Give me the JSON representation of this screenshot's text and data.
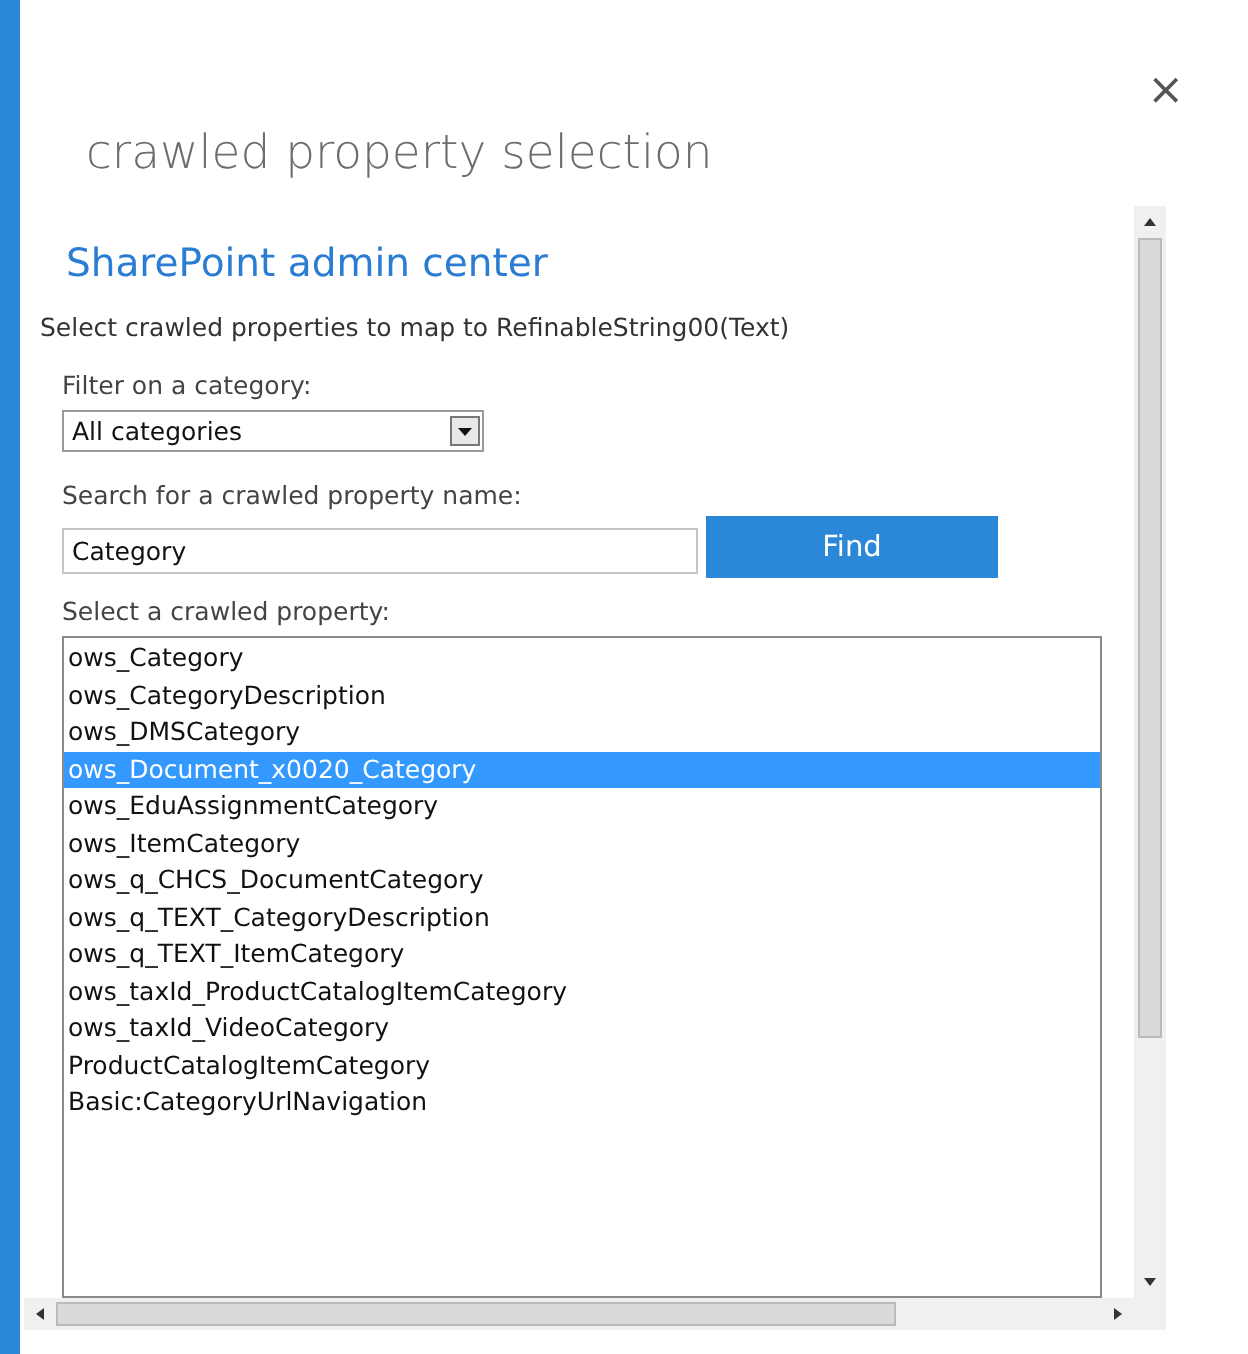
{
  "dialog": {
    "title": "crawled property selection",
    "close": "×"
  },
  "frame": {
    "heading": "SharePoint admin center",
    "description": "Select crawled properties to map to RefinableString00(Text)",
    "filter": {
      "label": "Filter on a category:",
      "value": "All categories"
    },
    "search": {
      "label": "Search for a crawled property name:",
      "value": "Category",
      "button": "Find"
    },
    "list": {
      "label": "Select a crawled property:",
      "items": [
        {
          "label": "ows_Category",
          "selected": false
        },
        {
          "label": "ows_CategoryDescription",
          "selected": false
        },
        {
          "label": "ows_DMSCategory",
          "selected": false
        },
        {
          "label": "ows_Document_x0020_Category",
          "selected": true
        },
        {
          "label": "ows_EduAssignmentCategory",
          "selected": false
        },
        {
          "label": "ows_ItemCategory",
          "selected": false
        },
        {
          "label": "ows_q_CHCS_DocumentCategory",
          "selected": false
        },
        {
          "label": "ows_q_TEXT_CategoryDescription",
          "selected": false
        },
        {
          "label": "ows_q_TEXT_ItemCategory",
          "selected": false
        },
        {
          "label": "ows_taxId_ProductCatalogItemCategory",
          "selected": false
        },
        {
          "label": "ows_taxId_VideoCategory",
          "selected": false
        },
        {
          "label": "ProductCatalogItemCategory",
          "selected": false
        },
        {
          "label": "Basic:CategoryUrlNavigation",
          "selected": false
        }
      ]
    }
  }
}
